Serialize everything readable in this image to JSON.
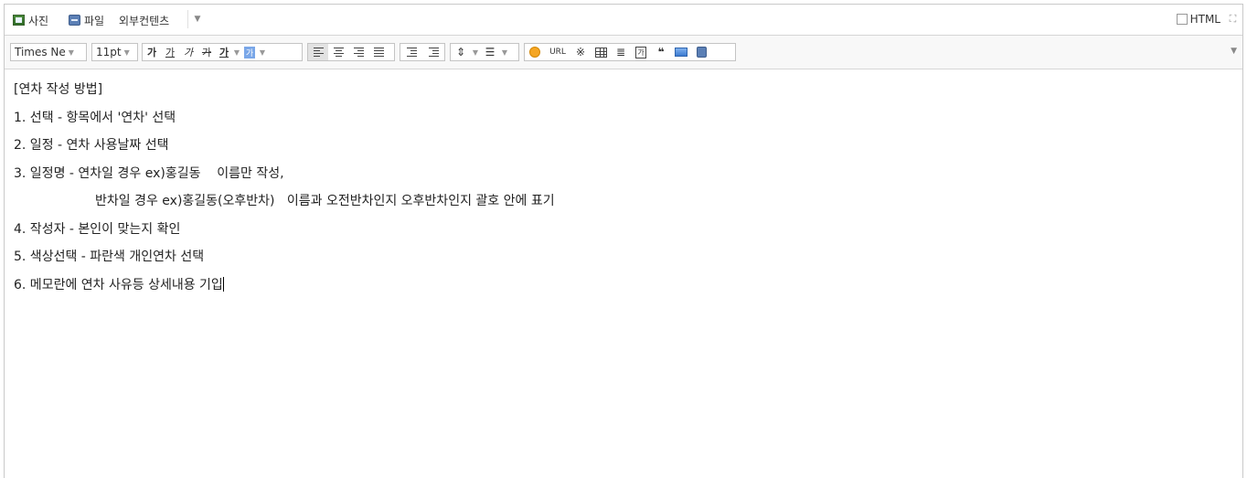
{
  "topbar": {
    "photo_label": "사진",
    "file_label": "파일",
    "external_label": "외부컨텐츠",
    "html_label": "HTML"
  },
  "toolbar": {
    "font_family": "Times Ne",
    "font_size": "11pt",
    "bold": "가",
    "underline": "가",
    "italic": "가",
    "strike": "가",
    "fontcolor": "가",
    "bgcolor": "가",
    "url": "URL",
    "special_char": "※",
    "textbox": "가",
    "quote": "❝"
  },
  "content": {
    "lines": [
      "[연차 작성 방법]",
      "1. 선택 - 항목에서 '연차' 선택",
      "2. 일정 - 연차 사용날짜 선택",
      "3. 일정명 - 연차일 경우 ex)홍길동    이름만 작성,",
      "반차일 경우 ex)홍길동(오후반차)   이름과 오전반차인지 오후반차인지 괄호 안에 표기",
      "4. 작성자 - 본인이 맞는지 확인",
      "5. 색상선택 - 파란색 개인연차 선택",
      "6. 메모란에 연차 사유등 상세내용 기입"
    ]
  },
  "colors": {
    "border": "#c9c9c9",
    "toolbar_bg": "#f8f8f8",
    "accent_blue": "#5b7fb5"
  }
}
